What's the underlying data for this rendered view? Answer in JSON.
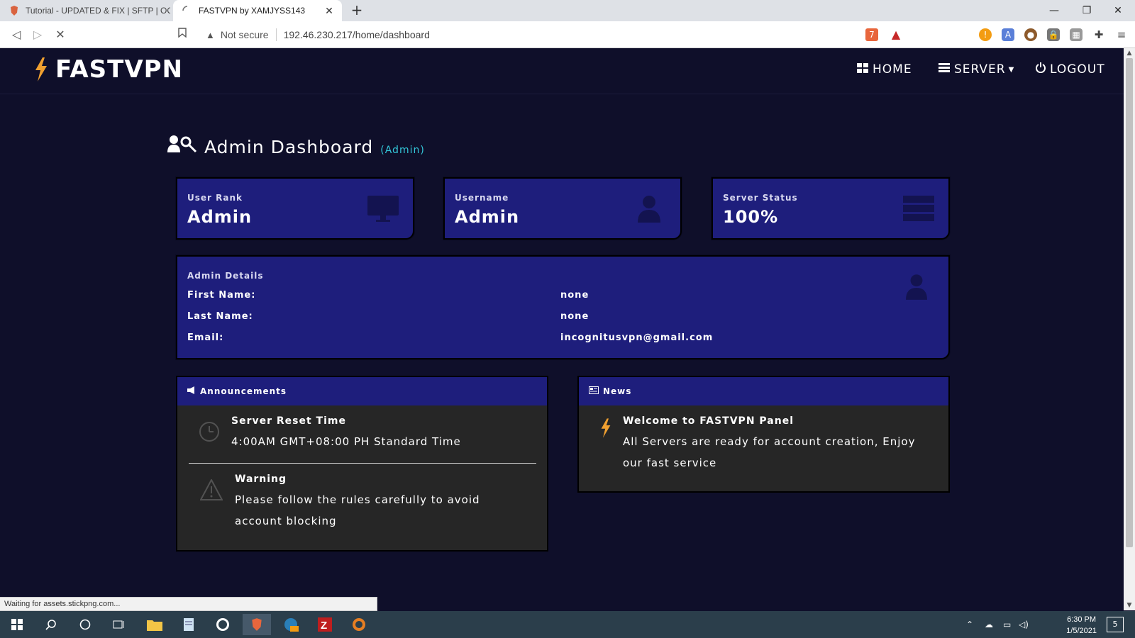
{
  "browser": {
    "tabs": [
      {
        "title": "Tutorial - UPDATED & FIX | SFTP | OCS",
        "active": false
      },
      {
        "title": "FASTVPN by XAMJYSS143",
        "active": true
      }
    ],
    "security_label": "Not secure",
    "url": "192.46.230.217/home/dashboard",
    "shield_count": "7",
    "status_text": "Waiting for assets.stickpng.com..."
  },
  "site": {
    "brand": "FASTVPN",
    "nav": {
      "home": "HOME",
      "server": "SERVER",
      "logout": "LOGOUT"
    }
  },
  "dashboard": {
    "title": "Admin Dashboard",
    "role": "(Admin)",
    "stats": [
      {
        "label": "User Rank",
        "value": "Admin",
        "icon": "monitor-icon"
      },
      {
        "label": "Username",
        "value": "Admin",
        "icon": "user-icon"
      },
      {
        "label": "Server Status",
        "value": "100%",
        "icon": "server-icon"
      }
    ],
    "details": {
      "heading": "Admin Details",
      "rows": [
        {
          "label": "First Name:",
          "value": "none"
        },
        {
          "label": "Last Name:",
          "value": "none"
        },
        {
          "label": "Email:",
          "value": "incognitusvpn@gmail.com"
        }
      ]
    },
    "announcements": {
      "heading": "Announcements",
      "items": [
        {
          "title": "Server Reset Time",
          "body": "4:00AM GMT+08:00 PH Standard Time",
          "icon": "clock-icon"
        },
        {
          "title": "Warning",
          "body": "Please follow the rules carefully to avoid account blocking",
          "icon": "warning-icon"
        }
      ]
    },
    "news": {
      "heading": "News",
      "items": [
        {
          "title": "Welcome to FASTVPN Panel",
          "body": "All Servers are ready for account creation, Enjoy our fast service",
          "icon": "bolt-icon"
        }
      ]
    }
  },
  "taskbar": {
    "time": "6:30 PM",
    "date": "1/5/2021",
    "notifications": "5"
  },
  "colors": {
    "page_bg": "#0f0f2a",
    "card_bg": "#1e1e7c",
    "panel_bg": "#262626",
    "accent_bolt": "#f0a030",
    "role_color": "#33c7d9"
  }
}
